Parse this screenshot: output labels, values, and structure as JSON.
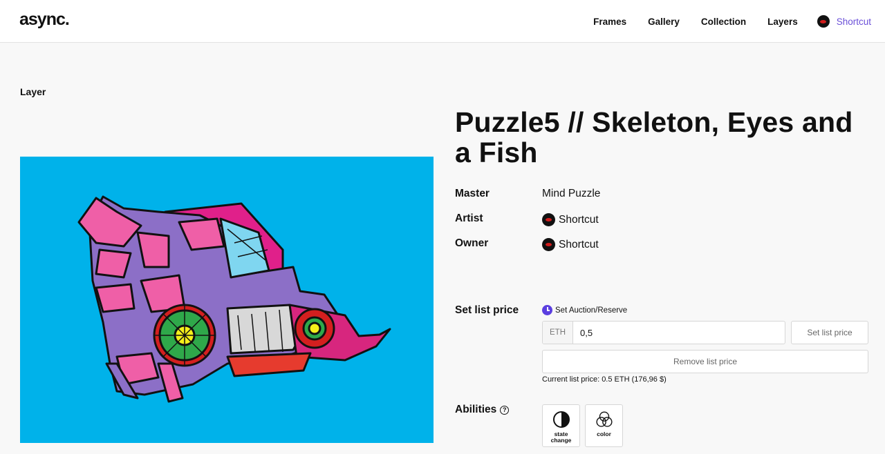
{
  "header": {
    "logo": "async.",
    "nav": [
      "Frames",
      "Gallery",
      "Collection",
      "Layers"
    ],
    "user": "Shortcut"
  },
  "page": {
    "section_label": "Layer",
    "title": "Puzzle5 // Skeleton, Eyes and a Fish",
    "artwork": {
      "alt": "",
      "background_color": "#00b2ea"
    }
  },
  "meta": {
    "master_label": "Master",
    "master_value": "Mind Puzzle",
    "artist_label": "Artist",
    "artist_value": "Shortcut",
    "owner_label": "Owner",
    "owner_value": "Shortcut"
  },
  "pricing": {
    "label": "Set list price",
    "auction_link": "Set Auction/Reserve",
    "currency": "ETH",
    "input_value": "0,5",
    "set_button": "Set list price",
    "remove_button": "Remove list price",
    "current_price": "Current list price: 0.5 ETH (176,96 $)"
  },
  "abilities": {
    "label": "Abilities",
    "items": [
      {
        "label": "state change",
        "icon": "half-circle-icon"
      },
      {
        "label": "color",
        "icon": "color-circles-icon"
      }
    ]
  },
  "colors": {
    "accent": "#6a4fd8",
    "artwork_bg": "#00b2ea",
    "clock": "#5b3fe0"
  }
}
